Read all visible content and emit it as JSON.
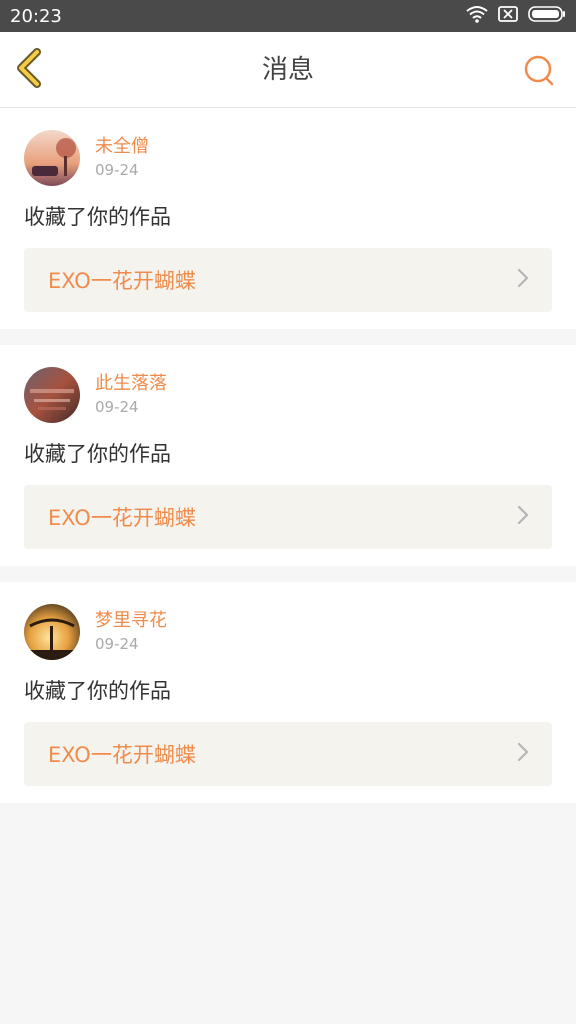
{
  "status_bar": {
    "time": "20:23",
    "icons": [
      "wifi-icon",
      "sim-disabled-icon",
      "battery-icon"
    ]
  },
  "header": {
    "title": "消息",
    "back_icon": "chevron-left-icon",
    "search_icon": "search-icon"
  },
  "colors": {
    "accent": "#f08c4b",
    "back_icon_stroke": "#6b5a2c",
    "back_icon_fill": "#f5cc45",
    "status_bar_bg": "#4a4a4a",
    "link_bg": "#f4f3ee",
    "page_bg": "#f6f6f6"
  },
  "notifications": [
    {
      "username": "未全僧",
      "date": "09-24",
      "action": "收藏了你的作品",
      "work_title": "EXO一花开蝴蝶"
    },
    {
      "username": "此生落落",
      "date": "09-24",
      "action": "收藏了你的作品",
      "work_title": "EXO一花开蝴蝶"
    },
    {
      "username": "梦里寻花",
      "date": "09-24",
      "action": "收藏了你的作品",
      "work_title": "EXO一花开蝴蝶"
    }
  ]
}
